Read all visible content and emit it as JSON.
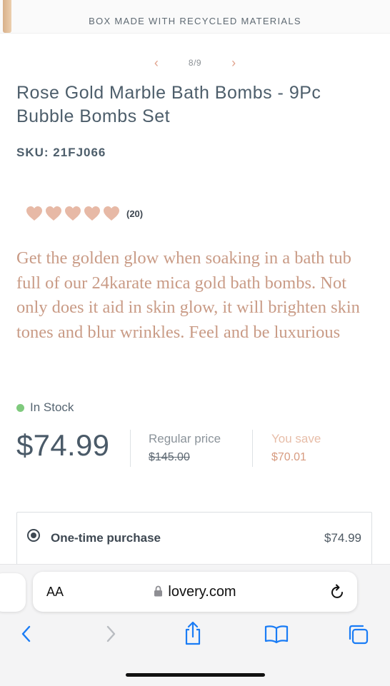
{
  "banner": {
    "text": "BOX MADE WITH RECYCLED MATERIALS"
  },
  "gallery": {
    "counter": "8/9",
    "prev_icon": "chevron-left-icon",
    "next_icon": "chevron-right-icon"
  },
  "product": {
    "title": "Rose Gold Marble Bath Bombs - 9Pc Bubble Bombs Set",
    "sku": "SKU: 21FJ066",
    "rating": {
      "hearts_filled": 5,
      "hearts_total": 5,
      "review_count": "(20)",
      "color": "#e7b9a6"
    },
    "description": "Get the golden glow when soaking in a bath tub full of our 24karate mica gold bath bombs. Not only does it aid in skin glow, it will brighten skin tones and blur wrinkles. Feel and be luxurious",
    "stock": {
      "label": "In Stock",
      "color": "#7fca7d"
    },
    "price": "$74.99",
    "regular_price_label": "Regular price",
    "regular_price": "$145.00",
    "you_save_label": "You save",
    "you_save_value": "$70.01"
  },
  "purchase_options": [
    {
      "label": "One-time purchase",
      "price": "$74.99",
      "selected": true
    }
  ],
  "browser": {
    "text_size_button": "AA",
    "domain": "lovery.com",
    "icons": [
      "lock-icon",
      "reload-icon",
      "back-icon",
      "forward-icon",
      "share-icon",
      "bookmarks-icon",
      "tabs-icon"
    ]
  },
  "colors": {
    "accent": "#c99b86",
    "heading": "#4d5e6b",
    "safari_blue": "#1a7cf5"
  }
}
